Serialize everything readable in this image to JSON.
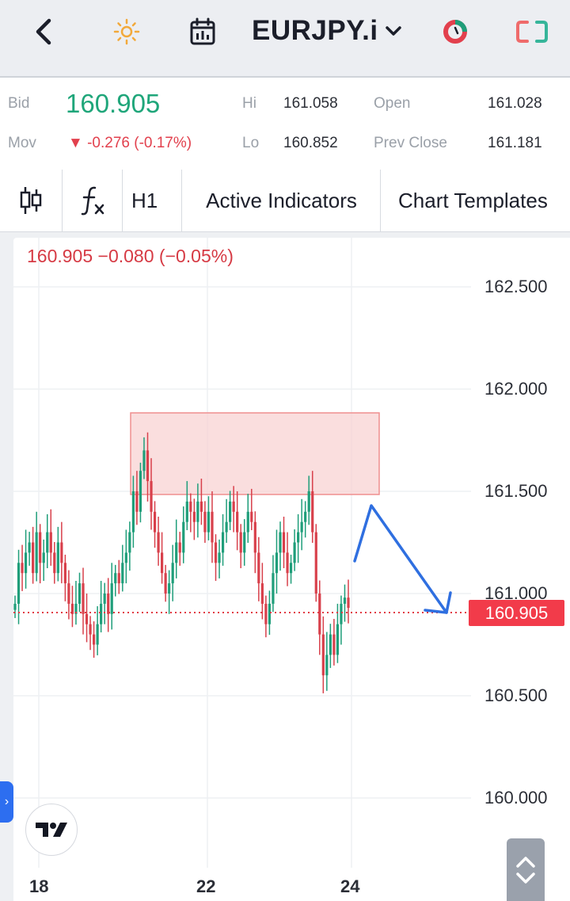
{
  "topbar": {
    "back_icon": "chevron-left-icon",
    "theme_icon": "sun-icon",
    "calendar_icon": "calendar-icon",
    "symbol": "EURJPY.i",
    "dropdown_icon": "chevron-down-icon",
    "timer_icon": "timer-ring-icon",
    "fullscreen_icon": "expand-frame-icon"
  },
  "quote": {
    "bid_label": "Bid",
    "bid_value": "160.905",
    "mov_label": "Mov",
    "mov_value": "▼ -0.276 (-0.17%)",
    "hi_label": "Hi",
    "hi_value": "161.058",
    "lo_label": "Lo",
    "lo_value": "160.852",
    "open_label": "Open",
    "open_value": "161.028",
    "prev_close_label": "Prev Close",
    "prev_close_value": "161.181"
  },
  "toolbar": {
    "candles_icon": "candlestick-icon",
    "fx_icon": "function-icon",
    "timeframe": "H1",
    "indicators": "Active Indicators",
    "templates": "Chart Templates"
  },
  "chart_header": "160.905  −0.080 (−0.05%)",
  "price_tag": "160.905",
  "colors": {
    "up": "#1f9e7a",
    "down": "#d8404b",
    "zone": "#f6c9c9",
    "arrow": "#2f6fe0"
  },
  "chart_data": {
    "type": "candlestick",
    "symbol": "EURJPY.i",
    "timeframe": "H1",
    "y_ticks": [
      "162.500",
      "162.000",
      "161.500",
      "161.000",
      "160.500",
      "160.000"
    ],
    "x_ticks": [
      "18",
      "22",
      "24"
    ],
    "ylim": [
      159.8,
      162.7
    ],
    "last_price": 160.905,
    "resistance_zone": [
      161.48,
      161.89
    ],
    "grid": true
  }
}
